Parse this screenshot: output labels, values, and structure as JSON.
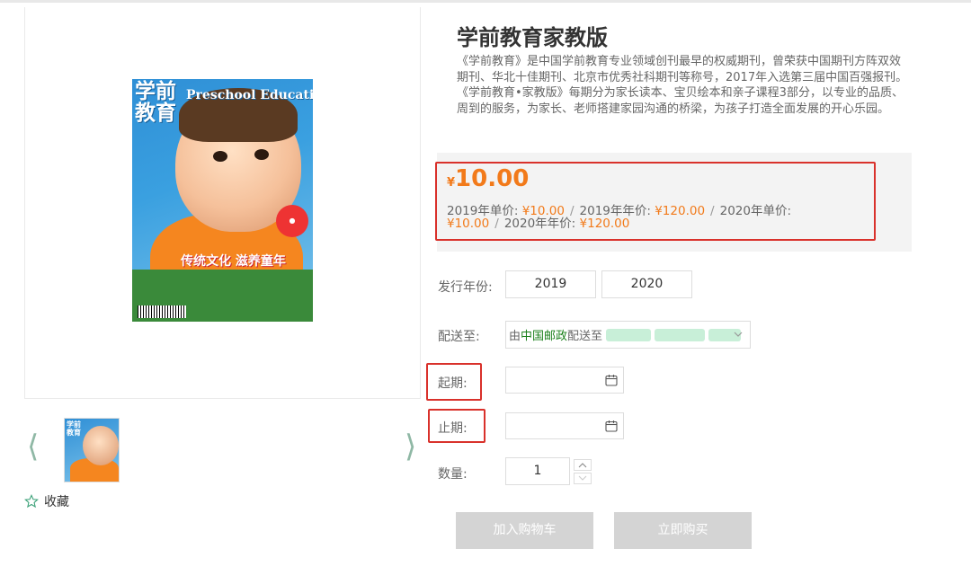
{
  "product": {
    "title": "学前教育家教版",
    "description": "《学前教育》是中国学前教育专业领域创刊最早的权威期刊，曾荣获中国期刊方阵双效期刊、华北十佳期刊、北京市优秀社科期刊等称号，2017年入选第三届中国百强报刊。《学前教育•家教版》每期分为家长读本、宝贝绘本和亲子课程3部分，以专业的品质、周到的服务，为家长、老师搭建家园沟通的桥梁，为孩子打造全面发展的开心乐园。",
    "cover": {
      "title_cn": "学前教育",
      "title_en": "Preschool Education",
      "slogan": "传统文化 滋养童年"
    }
  },
  "price": {
    "currency": "¥",
    "amount": "10.00",
    "items": [
      {
        "label": "2019年单价:",
        "value": "¥10.00"
      },
      {
        "label": "2019年年价:",
        "value": "¥120.00"
      },
      {
        "label": "2020年单价:",
        "value": "¥10.00"
      },
      {
        "label": "2020年年价:",
        "value": "¥120.00"
      }
    ],
    "separator": "/"
  },
  "form": {
    "year_label": "发行年份:",
    "years": [
      "2019",
      "2020"
    ],
    "ship_label": "配送至:",
    "ship_prefix": "由",
    "ship_carrier": "中国邮政",
    "ship_suffix": "配送至",
    "start_label": "起期:",
    "end_label": "止期:",
    "qty_label": "数量:",
    "qty_value": "1"
  },
  "actions": {
    "add_to_cart": "加入购物车",
    "buy_now": "立即购买",
    "favorite": "收藏"
  },
  "colors": {
    "price_orange": "#f27a1a",
    "highlight_red": "#d9312b",
    "carrier_green": "#1a7f1a",
    "disabled_button": "#d4d4d4"
  }
}
